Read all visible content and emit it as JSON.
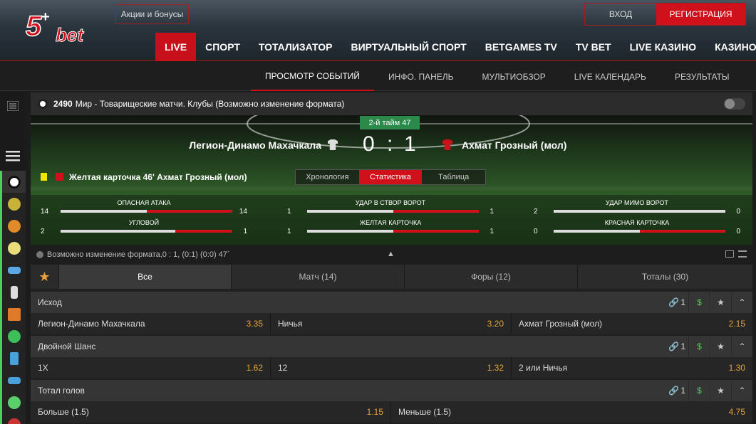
{
  "header": {
    "logo_text": "5+bet",
    "promo": "Акции и бонусы",
    "login": "ВХОД",
    "register": "РЕГИСТРАЦИЯ",
    "nav": [
      "LIVE",
      "СПОРТ",
      "ТОТАЛИЗАТОР",
      "ВИРТУАЛЬНЫЙ СПОРТ",
      "BETGAMES TV",
      "TV BET",
      "LIVE КАЗИНО",
      "КАЗИНО"
    ]
  },
  "subnav": [
    "ПРОСМОТР СОБЫТИЙ",
    "ИНФО. ПАНЕЛЬ",
    "МУЛЬТИОБЗОР",
    "LIVE КАЛЕНДАРЬ",
    "РЕЗУЛЬТАТЫ"
  ],
  "event": {
    "id": "2490",
    "title": "Мир - Товарищеские матчи. Клубы (Возможно изменение формата)",
    "period": "2-й тайм 47",
    "home": "Легион-Динамо Махачкала",
    "away": "Ахмат Грозный (мол)",
    "score_home": "0",
    "colon": ":",
    "score_away": "1",
    "last_event": "Желтая карточка 46' Ахмат Грозный (мол)",
    "view_tabs": [
      "Хронология",
      "Статистика",
      "Таблица"
    ],
    "info_line": "Возможно изменение формата,0 : 1, (0:1) (0:0) 47`"
  },
  "stats": [
    {
      "label": "ОПАСНАЯ АТАКА",
      "home": "14",
      "away": "14",
      "home_frac": 0.5
    },
    {
      "label": "УДАР В СТВОР ВОРОТ",
      "home": "1",
      "away": "1",
      "home_frac": 0.5
    },
    {
      "label": "УДАР МИМО ВОРОТ",
      "home": "2",
      "away": "0",
      "home_frac": 1
    },
    {
      "label": "УГЛОВОЙ",
      "home": "2",
      "away": "1",
      "home_frac": 0.67
    },
    {
      "label": "ЖЕЛТАЯ КАРТОЧКА",
      "home": "1",
      "away": "1",
      "home_frac": 0.5
    },
    {
      "label": "КРАСНАЯ КАРТОЧКА",
      "home": "0",
      "away": "0",
      "home_frac": 0.5
    }
  ],
  "filter_tabs": [
    "Все",
    "Матч (14)",
    "Форы (12)",
    "Тоталы (30)"
  ],
  "markets": [
    {
      "title": "Исход",
      "link_count": "1",
      "rows": [
        [
          {
            "name": "Легион-Динамо Махачкала",
            "odd": "3.35"
          },
          {
            "name": "Ничья",
            "odd": "3.20"
          },
          {
            "name": "Ахмат Грозный (мол)",
            "odd": "2.15"
          }
        ]
      ]
    },
    {
      "title": "Двойной Шанс",
      "link_count": "1",
      "rows": [
        [
          {
            "name": "1X",
            "odd": "1.62"
          },
          {
            "name": "12",
            "odd": "1.32"
          },
          {
            "name": "2 или Ничья",
            "odd": "1.30"
          }
        ]
      ]
    },
    {
      "title": "Тотал голов",
      "link_count": "1",
      "rows": [
        [
          {
            "name": "Больше (1.5)",
            "odd": "1.15"
          },
          {
            "name": "Меньше (1.5)",
            "odd": "4.75"
          }
        ]
      ]
    }
  ],
  "colors": {
    "accent": "#d0101a",
    "odd": "#e9a23b",
    "sport_bar": "#4bd05a"
  }
}
